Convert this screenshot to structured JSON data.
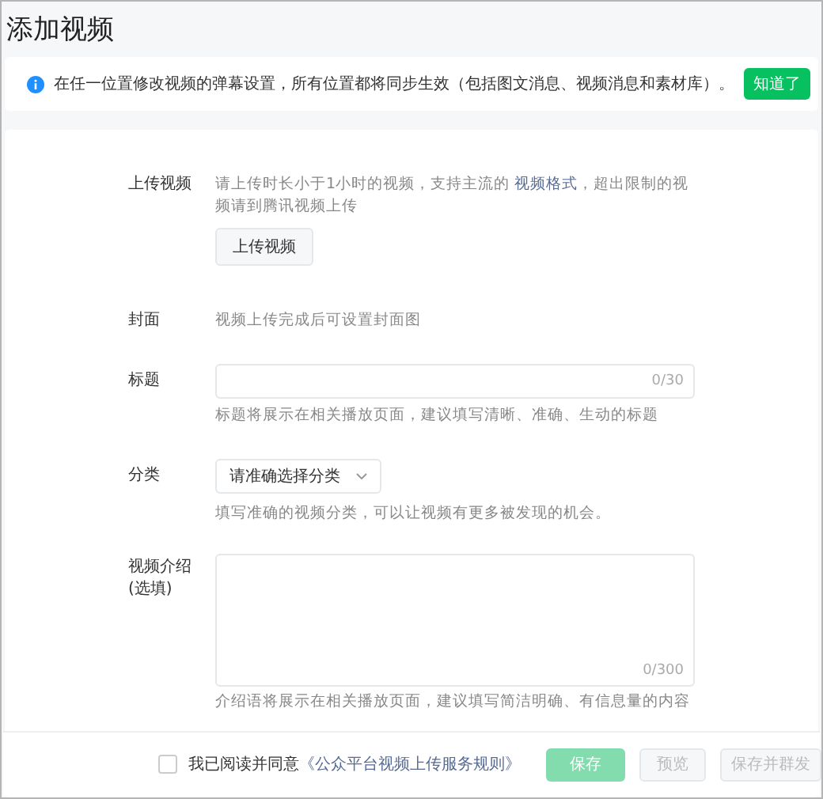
{
  "page_title": "添加视频",
  "notice": {
    "text": "在任一位置修改视频的弹幕设置，所有位置都将同步生效（包括图文消息、视频消息和素材库）。",
    "button": "知道了"
  },
  "form": {
    "upload": {
      "label": "上传视频",
      "hint_before": "请上传时长小于1小时的视频，支持主流的",
      "hint_link": "视频格式",
      "hint_after": "，超出限制的视频请到腾讯视频上传",
      "button": "上传视频"
    },
    "cover": {
      "label": "封面",
      "text": "视频上传完成后可设置封面图"
    },
    "title": {
      "label": "标题",
      "counter": "0/30",
      "hint": "标题将展示在相关播放页面，建议填写清晰、准确、生动的标题"
    },
    "category": {
      "label": "分类",
      "placeholder": "请准确选择分类",
      "hint": "填写准确的视频分类，可以让视频有更多被发现的机会。"
    },
    "intro": {
      "label_lines": [
        "视频介绍",
        "(选填)"
      ],
      "counter": "0/300",
      "hint": "介绍语将展示在相关播放页面，建议填写简洁明确、有信息量的内容"
    }
  },
  "footer": {
    "agree": {
      "checked": false,
      "text": "我已阅读并同意",
      "link": "《公众平台视频上传服务规则》"
    },
    "buttons": [
      {
        "label": "保存",
        "kind": "primary",
        "disabled": true
      },
      {
        "label": "预览",
        "kind": "default",
        "disabled": true
      },
      {
        "label": "保存并群发",
        "kind": "default",
        "disabled": true
      }
    ]
  }
}
